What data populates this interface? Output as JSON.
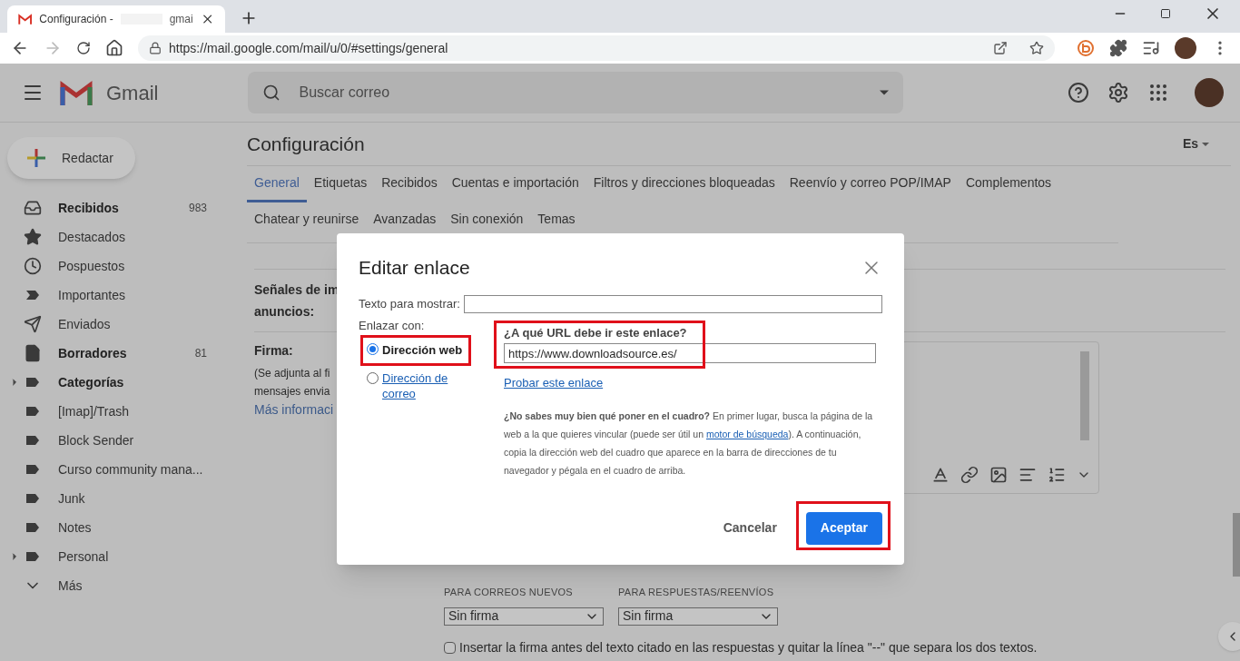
{
  "browser": {
    "tab": {
      "title": "Configuración -",
      "title_tail": "gmai"
    },
    "url": "https://mail.google.com/mail/u/0/#settings/general"
  },
  "header": {
    "app_name": "Gmail",
    "search": {
      "placeholder": "Buscar correo"
    }
  },
  "sidebar": {
    "compose": "Redactar",
    "items": [
      {
        "label": "Recibidos",
        "kind": "inbox",
        "bold": true,
        "count": "983",
        "expandable": false
      },
      {
        "label": "Destacados",
        "kind": "star",
        "bold": false,
        "expandable": false
      },
      {
        "label": "Pospuestos",
        "kind": "clock",
        "bold": false,
        "expandable": false
      },
      {
        "label": "Importantes",
        "kind": "important",
        "bold": false,
        "expandable": false
      },
      {
        "label": "Enviados",
        "kind": "send",
        "bold": false,
        "expandable": false
      },
      {
        "label": "Borradores",
        "kind": "draft",
        "bold": true,
        "count": "81",
        "expandable": false
      },
      {
        "label": "Categorías",
        "kind": "label",
        "bold": true,
        "expandable": true
      },
      {
        "label": "[Imap]/Trash",
        "kind": "label",
        "bold": false,
        "expandable": false
      },
      {
        "label": "Block Sender",
        "kind": "label",
        "bold": false,
        "expandable": false
      },
      {
        "label": "Curso community mana...",
        "kind": "label",
        "bold": false,
        "expandable": false
      },
      {
        "label": "Junk",
        "kind": "label",
        "bold": false,
        "expandable": false
      },
      {
        "label": "Notes",
        "kind": "label",
        "bold": false,
        "expandable": false
      },
      {
        "label": "Personal",
        "kind": "label",
        "bold": false,
        "expandable": true
      },
      {
        "label": "Más",
        "kind": "more",
        "bold": false,
        "expandable": false
      }
    ]
  },
  "settings": {
    "title": "Configuración",
    "language": "Es",
    "tabs": [
      {
        "label": "General",
        "selected": true
      },
      {
        "label": "Etiquetas",
        "selected": false
      },
      {
        "label": "Recibidos",
        "selected": false
      },
      {
        "label": "Cuentas e importación",
        "selected": false
      },
      {
        "label": "Filtros y direcciones bloqueadas",
        "selected": false
      },
      {
        "label": "Reenvío y correo POP/IMAP",
        "selected": false
      },
      {
        "label": "Complementos",
        "selected": false
      },
      {
        "label": "Chatear y reunirse",
        "selected": false
      },
      {
        "label": "Avanzadas",
        "selected": false
      },
      {
        "label": "Sin conexión",
        "selected": false
      },
      {
        "label": "Temas",
        "selected": false
      }
    ],
    "ads_label": [
      "Señales de im",
      "anuncios:"
    ],
    "signature": {
      "label": "Firma:",
      "note": [
        "(Se adjunta al fi",
        "mensajes envia"
      ],
      "link": "Más informaci"
    },
    "defaults": {
      "new_label": "PARA CORREOS NUEVOS",
      "new_value": "Sin firma",
      "reply_label": "PARA RESPUESTAS/REENVÍOS",
      "reply_value": "Sin firma"
    },
    "insert_before": {
      "label": "Insertar la firma antes del texto citado en las respuestas y quitar la línea \"--\" que separa los dos textos.",
      "checked": false
    }
  },
  "dialog": {
    "title": "Editar enlace",
    "text_label": "Texto para mostrar:",
    "link_to": "Enlazar con:",
    "options": [
      {
        "label": "Dirección web",
        "selected": true,
        "kind": "plain"
      },
      {
        "label": "Dirección de correo",
        "selected": false,
        "kind": "link"
      }
    ],
    "url_label": "¿A qué URL debe ir este enlace?",
    "url_value": "https://www.downloadsource.es/",
    "test_link": "Probar este enlace",
    "help_bold": "¿No sabes muy bien qué poner en el cuadro?",
    "help_1": " En primer lugar, busca la página de la web a la que quieres vincular (puede ser útil un ",
    "help_link": "motor de búsqueda",
    "help_2": "). A continuación, copia la dirección web del cuadro que aparece en la barra de direcciones de tu navegador y pégala en el cuadro de arriba.",
    "cancel": "Cancelar",
    "ok": "Aceptar"
  }
}
